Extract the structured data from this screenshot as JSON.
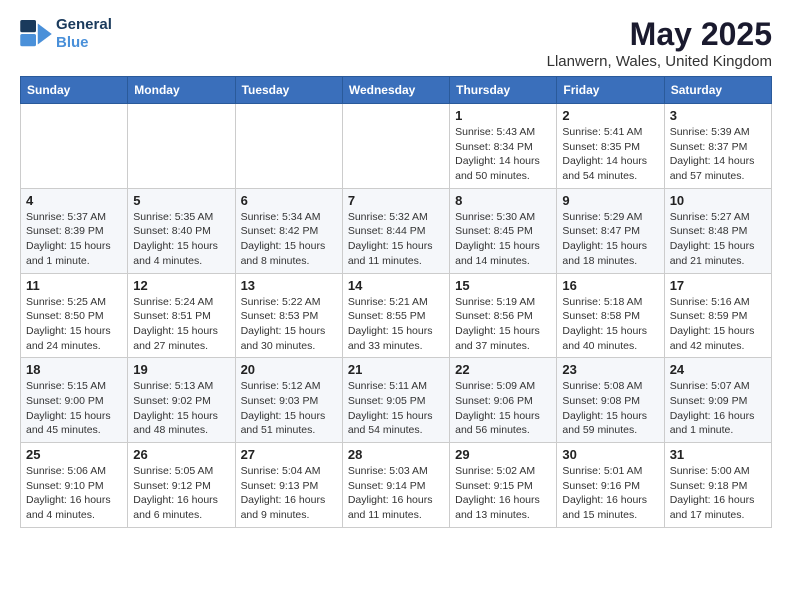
{
  "header": {
    "logo_line1": "General",
    "logo_line2": "Blue",
    "title": "May 2025",
    "location": "Llanwern, Wales, United Kingdom"
  },
  "weekdays": [
    "Sunday",
    "Monday",
    "Tuesday",
    "Wednesday",
    "Thursday",
    "Friday",
    "Saturday"
  ],
  "weeks": [
    [
      {
        "day": "",
        "info": ""
      },
      {
        "day": "",
        "info": ""
      },
      {
        "day": "",
        "info": ""
      },
      {
        "day": "",
        "info": ""
      },
      {
        "day": "1",
        "info": "Sunrise: 5:43 AM\nSunset: 8:34 PM\nDaylight: 14 hours\nand 50 minutes."
      },
      {
        "day": "2",
        "info": "Sunrise: 5:41 AM\nSunset: 8:35 PM\nDaylight: 14 hours\nand 54 minutes."
      },
      {
        "day": "3",
        "info": "Sunrise: 5:39 AM\nSunset: 8:37 PM\nDaylight: 14 hours\nand 57 minutes."
      }
    ],
    [
      {
        "day": "4",
        "info": "Sunrise: 5:37 AM\nSunset: 8:39 PM\nDaylight: 15 hours\nand 1 minute."
      },
      {
        "day": "5",
        "info": "Sunrise: 5:35 AM\nSunset: 8:40 PM\nDaylight: 15 hours\nand 4 minutes."
      },
      {
        "day": "6",
        "info": "Sunrise: 5:34 AM\nSunset: 8:42 PM\nDaylight: 15 hours\nand 8 minutes."
      },
      {
        "day": "7",
        "info": "Sunrise: 5:32 AM\nSunset: 8:44 PM\nDaylight: 15 hours\nand 11 minutes."
      },
      {
        "day": "8",
        "info": "Sunrise: 5:30 AM\nSunset: 8:45 PM\nDaylight: 15 hours\nand 14 minutes."
      },
      {
        "day": "9",
        "info": "Sunrise: 5:29 AM\nSunset: 8:47 PM\nDaylight: 15 hours\nand 18 minutes."
      },
      {
        "day": "10",
        "info": "Sunrise: 5:27 AM\nSunset: 8:48 PM\nDaylight: 15 hours\nand 21 minutes."
      }
    ],
    [
      {
        "day": "11",
        "info": "Sunrise: 5:25 AM\nSunset: 8:50 PM\nDaylight: 15 hours\nand 24 minutes."
      },
      {
        "day": "12",
        "info": "Sunrise: 5:24 AM\nSunset: 8:51 PM\nDaylight: 15 hours\nand 27 minutes."
      },
      {
        "day": "13",
        "info": "Sunrise: 5:22 AM\nSunset: 8:53 PM\nDaylight: 15 hours\nand 30 minutes."
      },
      {
        "day": "14",
        "info": "Sunrise: 5:21 AM\nSunset: 8:55 PM\nDaylight: 15 hours\nand 33 minutes."
      },
      {
        "day": "15",
        "info": "Sunrise: 5:19 AM\nSunset: 8:56 PM\nDaylight: 15 hours\nand 37 minutes."
      },
      {
        "day": "16",
        "info": "Sunrise: 5:18 AM\nSunset: 8:58 PM\nDaylight: 15 hours\nand 40 minutes."
      },
      {
        "day": "17",
        "info": "Sunrise: 5:16 AM\nSunset: 8:59 PM\nDaylight: 15 hours\nand 42 minutes."
      }
    ],
    [
      {
        "day": "18",
        "info": "Sunrise: 5:15 AM\nSunset: 9:00 PM\nDaylight: 15 hours\nand 45 minutes."
      },
      {
        "day": "19",
        "info": "Sunrise: 5:13 AM\nSunset: 9:02 PM\nDaylight: 15 hours\nand 48 minutes."
      },
      {
        "day": "20",
        "info": "Sunrise: 5:12 AM\nSunset: 9:03 PM\nDaylight: 15 hours\nand 51 minutes."
      },
      {
        "day": "21",
        "info": "Sunrise: 5:11 AM\nSunset: 9:05 PM\nDaylight: 15 hours\nand 54 minutes."
      },
      {
        "day": "22",
        "info": "Sunrise: 5:09 AM\nSunset: 9:06 PM\nDaylight: 15 hours\nand 56 minutes."
      },
      {
        "day": "23",
        "info": "Sunrise: 5:08 AM\nSunset: 9:08 PM\nDaylight: 15 hours\nand 59 minutes."
      },
      {
        "day": "24",
        "info": "Sunrise: 5:07 AM\nSunset: 9:09 PM\nDaylight: 16 hours\nand 1 minute."
      }
    ],
    [
      {
        "day": "25",
        "info": "Sunrise: 5:06 AM\nSunset: 9:10 PM\nDaylight: 16 hours\nand 4 minutes."
      },
      {
        "day": "26",
        "info": "Sunrise: 5:05 AM\nSunset: 9:12 PM\nDaylight: 16 hours\nand 6 minutes."
      },
      {
        "day": "27",
        "info": "Sunrise: 5:04 AM\nSunset: 9:13 PM\nDaylight: 16 hours\nand 9 minutes."
      },
      {
        "day": "28",
        "info": "Sunrise: 5:03 AM\nSunset: 9:14 PM\nDaylight: 16 hours\nand 11 minutes."
      },
      {
        "day": "29",
        "info": "Sunrise: 5:02 AM\nSunset: 9:15 PM\nDaylight: 16 hours\nand 13 minutes."
      },
      {
        "day": "30",
        "info": "Sunrise: 5:01 AM\nSunset: 9:16 PM\nDaylight: 16 hours\nand 15 minutes."
      },
      {
        "day": "31",
        "info": "Sunrise: 5:00 AM\nSunset: 9:18 PM\nDaylight: 16 hours\nand 17 minutes."
      }
    ]
  ]
}
